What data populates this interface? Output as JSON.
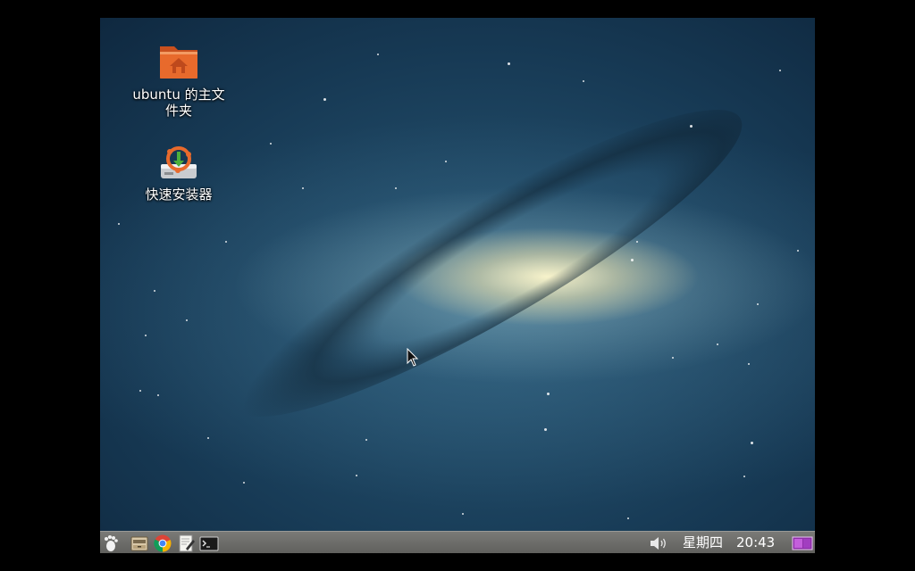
{
  "desktop": {
    "icons": [
      {
        "name": "home-folder",
        "label_line1": "ubuntu 的主文",
        "label_line2": "件夹",
        "icon": "folder-home-icon"
      },
      {
        "name": "quick-installer",
        "label_line1": "快速安装器",
        "icon": "installer-icon"
      }
    ]
  },
  "taskbar": {
    "launchers": [
      {
        "name": "main-menu",
        "icon": "foot-icon"
      },
      {
        "name": "file-manager",
        "icon": "file-cabinet-icon"
      },
      {
        "name": "browser",
        "icon": "chrome-icon"
      },
      {
        "name": "text-editor",
        "icon": "text-editor-icon"
      },
      {
        "name": "terminal",
        "icon": "terminal-icon"
      }
    ],
    "tray": {
      "volume_icon": "volume-icon",
      "weekday": "星期四",
      "time": "20:43",
      "workspace_icon": "workspace-switcher-icon"
    }
  },
  "colors": {
    "taskbar": "#6b6b68",
    "folder_orange": "#e86a2c",
    "accent_purple": "#b04cc9"
  }
}
